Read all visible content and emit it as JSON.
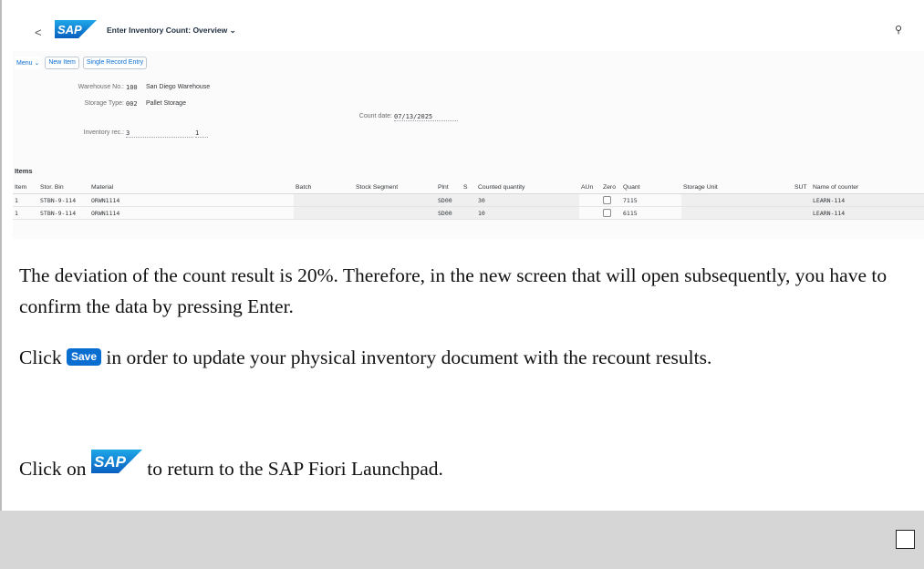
{
  "app": {
    "back_glyph": "<",
    "logo_text": "SAP",
    "title": "Enter Inventory Count: Overview ⌄",
    "search_glyph": "⚲"
  },
  "toolbar": {
    "menu_label": "Menu ⌄",
    "new_item_label": "New Item",
    "single_record_label": "Single Record Entry"
  },
  "form": {
    "warehouse_label": "Warehouse No.:",
    "warehouse_value": "100",
    "warehouse_text": "San Diego Warehouse",
    "storage_type_label": "Storage Type:",
    "storage_type_value": "002",
    "storage_type_text": "Pallet Storage",
    "count_date_label": "Count date:",
    "count_date_value": "07/13/2025",
    "inventory_rec_label": "Inventory rec.:",
    "inventory_rec_value": "3",
    "inventory_rec_value2": "1"
  },
  "items": {
    "title": "Items",
    "columns": [
      "Item",
      "Stor. Bin",
      "Material",
      "Batch",
      "Stock Segment",
      "Plnt",
      "S",
      "Counted quantity",
      "AUn",
      "Zero",
      "Quant",
      "Storage Unit",
      "SUT",
      "Name of counter"
    ],
    "rows": [
      {
        "item": "1",
        "bin": "STBN-9-114",
        "material": "ORWN1114",
        "batch": "",
        "segment": "",
        "plant": "SD00",
        "s": "",
        "qty": "30",
        "aun": "",
        "quant": "7115",
        "su": "",
        "sut": "",
        "counter": "LEARN-114"
      },
      {
        "item": "1",
        "bin": "STBN-9-114",
        "material": "ORWN1114",
        "batch": "",
        "segment": "",
        "plant": "SD00",
        "s": "",
        "qty": "10",
        "aun": "",
        "quant": "6115",
        "su": "",
        "sut": "",
        "counter": "LEARN-114"
      }
    ]
  },
  "instructions": {
    "p1": "The deviation of the count result is 20%. Therefore, in the new screen that will open subsequently, you have to confirm the data by pressing Enter.",
    "p2_before": "Click ",
    "p2_button": "Save",
    "p2_after": " in order to update your physical inventory document with the recount results.",
    "p3_before": "Click on ",
    "p3_logo": "SAP",
    "p3_after": " to return to the SAP Fiori Launchpad."
  },
  "colors": {
    "sap_blue": "#0a6ed1",
    "footer_gray": "#d6d6d6"
  }
}
